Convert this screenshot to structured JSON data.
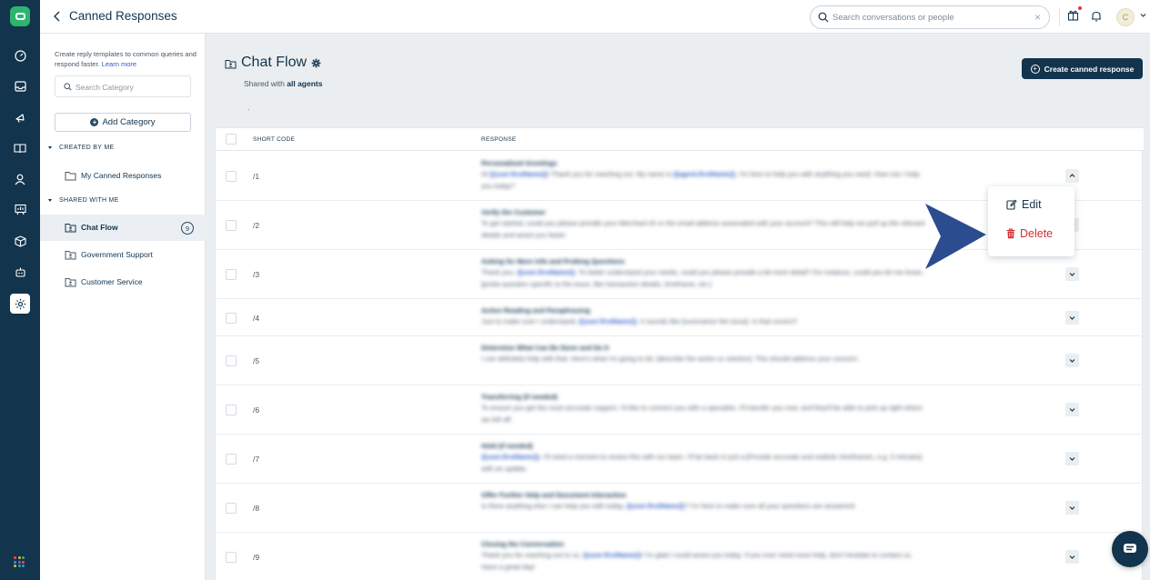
{
  "header": {
    "title": "Canned Responses",
    "search_placeholder": "Search conversations or people",
    "clear_glyph": "×",
    "avatar_initial": "C"
  },
  "rail": {
    "icons": [
      "app-logo-icon",
      "dashboard-icon",
      "inbox-icon",
      "campaigns-icon",
      "knowledge-base-icon",
      "contacts-icon",
      "reports-icon",
      "integrations-icon",
      "bots-icon",
      "settings-icon",
      "apps-grid-icon"
    ],
    "active": "settings-icon"
  },
  "categories": {
    "intro_text": "Create reply templates to common queries and respond faster.",
    "learn_more": "Learn more",
    "search_placeholder": "Search Category",
    "add_label": "Add Category",
    "created_by_me": "CREATED BY ME",
    "shared_with_me": "SHARED WITH ME",
    "items": [
      {
        "label": "My Canned Responses"
      },
      {
        "label": "Chat Flow",
        "count": "9"
      },
      {
        "label": "Government Support"
      },
      {
        "label": "Customer Service"
      }
    ]
  },
  "main": {
    "title": "Chat Flow",
    "shared_prefix": "Shared with",
    "shared_with": "all agents",
    "dot_text": ".",
    "create_label": "Create canned response",
    "columns": {
      "short_code": "SHORT CODE",
      "response": "RESPONSE"
    },
    "rows": [
      {
        "code": "/1",
        "title": "Personalized Greetings",
        "body": [
          "Hi ",
          "{{user.firstName}}",
          "! Thank you for reaching out. My name is ",
          "{{agent.firstName}}",
          ", I'm here to help you with anything you need. How can I help you today?"
        ]
      },
      {
        "code": "/2",
        "title": "Verify the Customer",
        "body": [
          "To get started, could you please provide your Merchant ID or the email address associated with your account? This will help me pull up the relevant details and assist you faster."
        ]
      },
      {
        "code": "/3",
        "title": "Asking for More Info and Probing Questions",
        "body": [
          "Thank you, ",
          "{{user.firstName}}",
          ". To better understand your needs, could you please provide a bit more detail? For instance, could you let me know... [probe question specific to the issue, like transaction details, timeframe, etc.]"
        ]
      },
      {
        "code": "/4",
        "title": "Active Reading and Paraphrasing",
        "body": [
          "Just to make sure I understand, ",
          "{{user.firstName}}",
          ", it sounds like [summarize the issue]. Is that correct?"
        ]
      },
      {
        "code": "/5",
        "title": "Determine What Can Be Done and Do It",
        "body": [
          "I can definitely help with that. Here's what I'm going to do: [describe the action or solution]. This should address your concern."
        ]
      },
      {
        "code": "/6",
        "title": "Transferring (if needed)",
        "body": [
          "To ensure you get the most accurate support, I'd like to connect you with a specialist. I'll transfer you now, and they'll be able to pick up right where we left off."
        ]
      },
      {
        "code": "/7",
        "title": "Hold (if needed)",
        "body": [
          "{{user.firstName}}",
          ", I'll need a moment to review this with our team. I'll be back in just a [Provide accurate and realistic timeframes, e.g. 5 minutes] with an update."
        ]
      },
      {
        "code": "/8",
        "title": "Offer Further Help and Document Interaction",
        "body": [
          "Is there anything else I can help you with today, ",
          "{{user.firstName}}",
          "? I'm here to make sure all your questions are answered."
        ]
      },
      {
        "code": "/9",
        "title": "Closing the Conversation",
        "body": [
          "Thank you for reaching out to us, ",
          "{{user.firstName}}",
          "! I'm glad I could assist you today. If you ever need more help, don't hesitate to contact us. Have a great day!"
        ]
      }
    ]
  },
  "menu": {
    "edit_label": "Edit",
    "delete_label": "Delete"
  },
  "colors": {
    "rail_bg": "#12344d",
    "brand_green": "#2bb56f",
    "primary_dark": "#12344d",
    "delete_red": "#d72d30",
    "link_blue": "#2c5cc5",
    "arrow_blue": "#2b4c8f"
  }
}
